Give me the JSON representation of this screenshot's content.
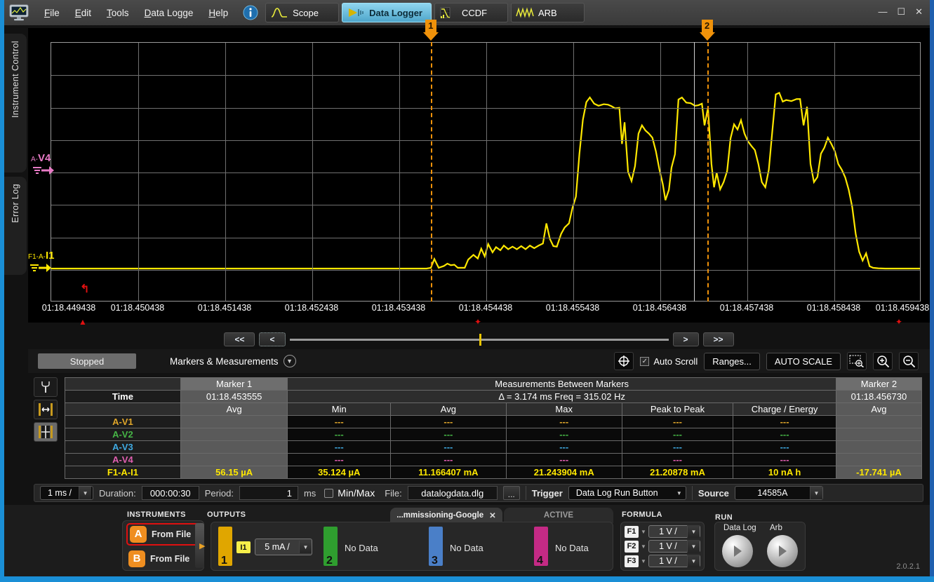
{
  "app": {
    "version": "2.0.2.1",
    "logo_icon": "monitor-icon"
  },
  "menubar": {
    "items": [
      {
        "label": "File",
        "accel": "F"
      },
      {
        "label": "Edit",
        "accel": "E"
      },
      {
        "label": "Tools",
        "accel": "T"
      },
      {
        "label": "Data Logge",
        "accel": "D"
      },
      {
        "label": "Help",
        "accel": "H"
      }
    ],
    "info_icon": "info-icon",
    "tabs": [
      {
        "label": "Scope",
        "icon": "scope-wave-icon",
        "active": false
      },
      {
        "label": "Data Logger",
        "icon": "datalogger-icon",
        "active": true
      },
      {
        "label": "CCDF",
        "icon": "ccdf-icon",
        "active": false
      },
      {
        "label": "ARB",
        "icon": "arb-wave-icon",
        "active": false
      }
    ],
    "window_controls": [
      "minimize",
      "maximize",
      "close"
    ]
  },
  "side_tabs": [
    {
      "label": "Instrument Control"
    },
    {
      "label": "Error Log"
    }
  ],
  "chart_data": {
    "type": "line",
    "title": "",
    "xlabel": "",
    "ylabel": "",
    "grid": true,
    "x_ticks": [
      "01:18.449438",
      "01:18.450438",
      "01:18.451438",
      "01:18.452438",
      "01:18.453438",
      "01:18.454438",
      "01:18.455438",
      "01:18.456438",
      "01:18.457438",
      "01:18.458438",
      "01:18.459438"
    ],
    "channel_labels": [
      {
        "prefix": "A-",
        "name": "V4",
        "color": "#e87bc6",
        "y_frac": 0.5
      },
      {
        "prefix": "F1-A-",
        "name": "I1",
        "color": "#ffe800",
        "y_frac": 0.875
      }
    ],
    "markers": [
      {
        "id": "1",
        "label": "1",
        "time": "01:18.453555",
        "x_frac": 0.437,
        "color": "#f0920a"
      },
      {
        "id": "2",
        "label": "2",
        "time": "01:18.456730",
        "x_frac": 0.7545,
        "color": "#f0920a"
      }
    ],
    "trace_color": "#ffe800",
    "baseline_y_frac": 0.875,
    "series": [
      {
        "name": "F1-A-I1",
        "points": [
          [
            0.0,
            0.875
          ],
          [
            0.42,
            0.875
          ],
          [
            0.432,
            0.875
          ],
          [
            0.437,
            0.872
          ],
          [
            0.441,
            0.838
          ],
          [
            0.446,
            0.872
          ],
          [
            0.452,
            0.865
          ],
          [
            0.456,
            0.856
          ],
          [
            0.46,
            0.862
          ],
          [
            0.464,
            0.86
          ],
          [
            0.468,
            0.872
          ],
          [
            0.476,
            0.872
          ],
          [
            0.48,
            0.84
          ],
          [
            0.486,
            0.822
          ],
          [
            0.491,
            0.836
          ],
          [
            0.495,
            0.798
          ],
          [
            0.499,
            0.828
          ],
          [
            0.503,
            0.78
          ],
          [
            0.508,
            0.812
          ],
          [
            0.512,
            0.792
          ],
          [
            0.517,
            0.804
          ],
          [
            0.521,
            0.786
          ],
          [
            0.526,
            0.8
          ],
          [
            0.531,
            0.79
          ],
          [
            0.536,
            0.8
          ],
          [
            0.541,
            0.788
          ],
          [
            0.546,
            0.8
          ],
          [
            0.551,
            0.786
          ],
          [
            0.556,
            0.796
          ],
          [
            0.561,
            0.786
          ],
          [
            0.566,
            0.778
          ],
          [
            0.57,
            0.7
          ],
          [
            0.574,
            0.76
          ],
          [
            0.578,
            0.788
          ],
          [
            0.582,
            0.79
          ],
          [
            0.587,
            0.74
          ],
          [
            0.591,
            0.716
          ],
          [
            0.596,
            0.7
          ],
          [
            0.6,
            0.64
          ],
          [
            0.604,
            0.596
          ],
          [
            0.608,
            0.43
          ],
          [
            0.612,
            0.298
          ],
          [
            0.616,
            0.23
          ],
          [
            0.62,
            0.212
          ],
          [
            0.625,
            0.236
          ],
          [
            0.63,
            0.244
          ],
          [
            0.636,
            0.238
          ],
          [
            0.641,
            0.24
          ],
          [
            0.645,
            0.246
          ],
          [
            0.649,
            0.254
          ],
          [
            0.654,
            0.252
          ],
          [
            0.657,
            0.392
          ],
          [
            0.66,
            0.308
          ],
          [
            0.664,
            0.5
          ],
          [
            0.668,
            0.536
          ],
          [
            0.672,
            0.478
          ],
          [
            0.676,
            0.352
          ],
          [
            0.68,
            0.32
          ],
          [
            0.684,
            0.34
          ],
          [
            0.688,
            0.352
          ],
          [
            0.692,
            0.368
          ],
          [
            0.696,
            0.42
          ],
          [
            0.7,
            0.49
          ],
          [
            0.704,
            0.548
          ],
          [
            0.707,
            0.61
          ],
          [
            0.711,
            0.57
          ],
          [
            0.714,
            0.484
          ],
          [
            0.718,
            0.432
          ],
          [
            0.722,
            0.22
          ],
          [
            0.726,
            0.212
          ],
          [
            0.731,
            0.232
          ],
          [
            0.736,
            0.234
          ],
          [
            0.741,
            0.244
          ],
          [
            0.745,
            0.242
          ],
          [
            0.749,
            0.236
          ],
          [
            0.752,
            0.32
          ],
          [
            0.756,
            0.252
          ],
          [
            0.76,
            0.47
          ],
          [
            0.763,
            0.56
          ],
          [
            0.766,
            0.504
          ],
          [
            0.77,
            0.568
          ],
          [
            0.774,
            0.54
          ],
          [
            0.778,
            0.498
          ],
          [
            0.782,
            0.37
          ],
          [
            0.786,
            0.316
          ],
          [
            0.79,
            0.336
          ],
          [
            0.794,
            0.3
          ],
          [
            0.798,
            0.352
          ],
          [
            0.802,
            0.382
          ],
          [
            0.806,
            0.4
          ],
          [
            0.81,
            0.416
          ],
          [
            0.814,
            0.47
          ],
          [
            0.818,
            0.54
          ],
          [
            0.822,
            0.56
          ],
          [
            0.826,
            0.492
          ],
          [
            0.83,
            0.344
          ],
          [
            0.834,
            0.2
          ],
          [
            0.838,
            0.194
          ],
          [
            0.842,
            0.228
          ],
          [
            0.846,
            0.222
          ],
          [
            0.852,
            0.226
          ],
          [
            0.858,
            0.218
          ],
          [
            0.862,
            0.218
          ],
          [
            0.866,
            0.32
          ],
          [
            0.87,
            0.248
          ],
          [
            0.874,
            0.47
          ],
          [
            0.878,
            0.54
          ],
          [
            0.882,
            0.52
          ],
          [
            0.886,
            0.43
          ],
          [
            0.89,
            0.406
          ],
          [
            0.894,
            0.368
          ],
          [
            0.898,
            0.392
          ],
          [
            0.902,
            0.42
          ],
          [
            0.906,
            0.47
          ],
          [
            0.91,
            0.492
          ],
          [
            0.914,
            0.522
          ],
          [
            0.918,
            0.57
          ],
          [
            0.922,
            0.636
          ],
          [
            0.926,
            0.74
          ],
          [
            0.93,
            0.81
          ],
          [
            0.934,
            0.844
          ],
          [
            0.938,
            0.816
          ],
          [
            0.942,
            0.866
          ],
          [
            0.946,
            0.872
          ],
          [
            0.952,
            0.874
          ],
          [
            0.96,
            0.875
          ],
          [
            1.0,
            0.875
          ]
        ]
      }
    ]
  },
  "navbar": {
    "first_label": "<<",
    "prev_label": "<",
    "next_label": ">",
    "last_label": ">>",
    "thumb_position_pct": 50
  },
  "toolbar": {
    "status": "Stopped",
    "markers_measurements": "Markers & Measurements",
    "chevron_icon": "chevron-down-circle-icon",
    "crosshair_icon": "crosshair-icon",
    "auto_scroll_label": "Auto Scroll",
    "auto_scroll_checked": true,
    "ranges_label": "Ranges...",
    "auto_scale_label": "AUTO SCALE",
    "zoom_box_icon": "zoom-box-icon",
    "zoom_in_icon": "zoom-in-icon",
    "zoom_out_icon": "zoom-out-icon"
  },
  "meas_side_icons": [
    {
      "name": "marker-tool-icon",
      "selected": false
    },
    {
      "name": "marker-span-icon",
      "selected": false
    },
    {
      "name": "grid-table-icon",
      "selected": true
    }
  ],
  "measurements": {
    "marker1_header": "Marker 1",
    "between_header": "Measurements Between Markers",
    "marker2_header": "Marker 2",
    "time_label": "Time",
    "marker1_time": "01:18.453555",
    "delta_text": "Δ = 3.174 ms   Freq = 315.02 Hz",
    "marker2_time": "01:18.456730",
    "sub_headers": {
      "m1": "Avg",
      "min": "Min",
      "avg": "Avg",
      "max": "Max",
      "p2p": "Peak to Peak",
      "charge": "Charge / Energy",
      "m2": "Avg"
    },
    "rows": [
      {
        "label": "A-V1",
        "color": "#e0a62a",
        "m1": "",
        "min": "---",
        "avg": "---",
        "max": "---",
        "p2p": "---",
        "charge": "---",
        "m2": ""
      },
      {
        "label": "A-V2",
        "color": "#46b546",
        "m1": "",
        "min": "---",
        "avg": "---",
        "max": "---",
        "p2p": "---",
        "charge": "---",
        "m2": ""
      },
      {
        "label": "A-V3",
        "color": "#3fa9e0",
        "m1": "",
        "min": "---",
        "avg": "---",
        "max": "---",
        "p2p": "---",
        "charge": "---",
        "m2": ""
      },
      {
        "label": "A-V4",
        "color": "#e05fb0",
        "m1": "",
        "min": "---",
        "avg": "---",
        "max": "---",
        "p2p": "---",
        "charge": "---",
        "m2": ""
      },
      {
        "label": "F1-A-I1",
        "color": "#ffe800",
        "m1": "56.15 µA",
        "min": "35.124 µA",
        "avg": "11.166407 mA",
        "max": "21.243904 mA",
        "p2p": "21.20878 mA",
        "charge": "10 nA h",
        "m2": "-17.741 µA"
      }
    ]
  },
  "options": {
    "timebase_value": "1 ms /",
    "duration_label": "Duration:",
    "duration_value": "000:00:30",
    "period_label": "Period:",
    "period_value": "1",
    "period_unit": "ms",
    "minmax_label": "Min/Max",
    "minmax_checked": false,
    "file_label": "File:",
    "file_value": "datalogdata.dlg",
    "browse_label": "...",
    "trigger_label": "Trigger",
    "trigger_value": "Data Log Run Button",
    "source_label": "Source",
    "source_value": "14585A"
  },
  "bottom": {
    "instruments_title": "INSTRUMENTS",
    "outputs_title": "OUTPUTS",
    "formula_title": "FORMULA",
    "run_title": "RUN",
    "instruments": [
      {
        "key": "A",
        "label": "From File",
        "selected": true
      },
      {
        "key": "B",
        "label": "From File",
        "selected": false
      }
    ],
    "outputs": [
      {
        "num": "1",
        "color": "#e0a600",
        "badge": "I1",
        "range": "5 mA /",
        "has_data": true,
        "nodata": ""
      },
      {
        "num": "2",
        "color": "#2f9e2f",
        "badge": "",
        "range": "",
        "has_data": false,
        "nodata": "No Data"
      },
      {
        "num": "3",
        "color": "#4a7fc8",
        "badge": "",
        "range": "",
        "has_data": false,
        "nodata": "No Data"
      },
      {
        "num": "4",
        "color": "#c42a85",
        "badge": "",
        "range": "",
        "has_data": false,
        "nodata": "No Data"
      }
    ],
    "tabs": [
      {
        "label": "...mmissioning-Google",
        "active": true,
        "closable": true
      },
      {
        "label": "ACTIVE",
        "active": false,
        "closable": false
      }
    ],
    "formulas": [
      {
        "name": "F1",
        "range": "1 V /"
      },
      {
        "name": "F2",
        "range": "1 V /"
      },
      {
        "name": "F3",
        "range": "1 V /"
      }
    ],
    "run": [
      {
        "label": "Data Log",
        "icon": "play-icon"
      },
      {
        "label": "Arb",
        "icon": "play-icon"
      }
    ]
  }
}
